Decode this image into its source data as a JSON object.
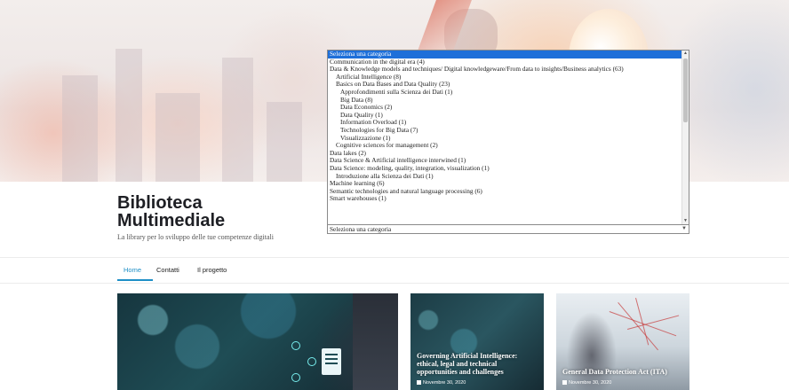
{
  "brand": {
    "title": "Biblioteca Multimediale",
    "tagline": "La library per lo sviluppo delle tue competenze digitali"
  },
  "category_select": {
    "selected": "Seleziona una categoria",
    "options": [
      {
        "label": "Seleziona una categoria",
        "depth": 0,
        "selected": true
      },
      {
        "label": "Communication in the digital era  (4)",
        "depth": 0
      },
      {
        "label": "Data & Knowledge models and techniques/ Digital knowledgeware/From data to insights/Business analytics  (63)",
        "depth": 0
      },
      {
        "label": "Artificial Intelligence  (8)",
        "depth": 1
      },
      {
        "label": "Basics on Data Bases and Data Quality  (23)",
        "depth": 1
      },
      {
        "label": "Approfondimenti sulla Scienza dei Dati  (1)",
        "depth": 2
      },
      {
        "label": "Big Data  (8)",
        "depth": 2
      },
      {
        "label": "Data Economics  (2)",
        "depth": 2
      },
      {
        "label": "Data Quality  (1)",
        "depth": 2
      },
      {
        "label": "Information Overload  (1)",
        "depth": 2
      },
      {
        "label": "Technologies for Big Data  (7)",
        "depth": 2
      },
      {
        "label": "Visualizzazione  (1)",
        "depth": 2
      },
      {
        "label": "Cognitive sciences for management  (2)",
        "depth": 1
      },
      {
        "label": "Data lakes  (2)",
        "depth": 0
      },
      {
        "label": "Data Science & Artificial intelligence interwined  (1)",
        "depth": 0
      },
      {
        "label": "Data Science: modeling, quality, integration, visualization  (1)",
        "depth": 0
      },
      {
        "label": "Introduzione alla Scienza dei Dati  (1)",
        "depth": 1
      },
      {
        "label": "Machine learning  (6)",
        "depth": 0
      },
      {
        "label": "Semantic technologies and natural language processing  (6)",
        "depth": 0
      },
      {
        "label": "Smart warehouses  (1)",
        "depth": 0
      }
    ]
  },
  "nav": {
    "items": [
      {
        "label": "Home",
        "active": true
      },
      {
        "label": "Contatti"
      },
      {
        "label": "Il progetto"
      }
    ]
  },
  "cards": [
    {
      "title": "",
      "date": ""
    },
    {
      "title": "Governing Artificial Intelligence: ethical, legal and technical opportunities and challenges",
      "date": "Novembre 30, 2020"
    },
    {
      "title": "General Data Protection Act (ITA)",
      "date": "Novembre 30, 2020"
    }
  ],
  "colors": {
    "accent": "#1e8fc6",
    "select_highlight": "#1e6fd9"
  }
}
